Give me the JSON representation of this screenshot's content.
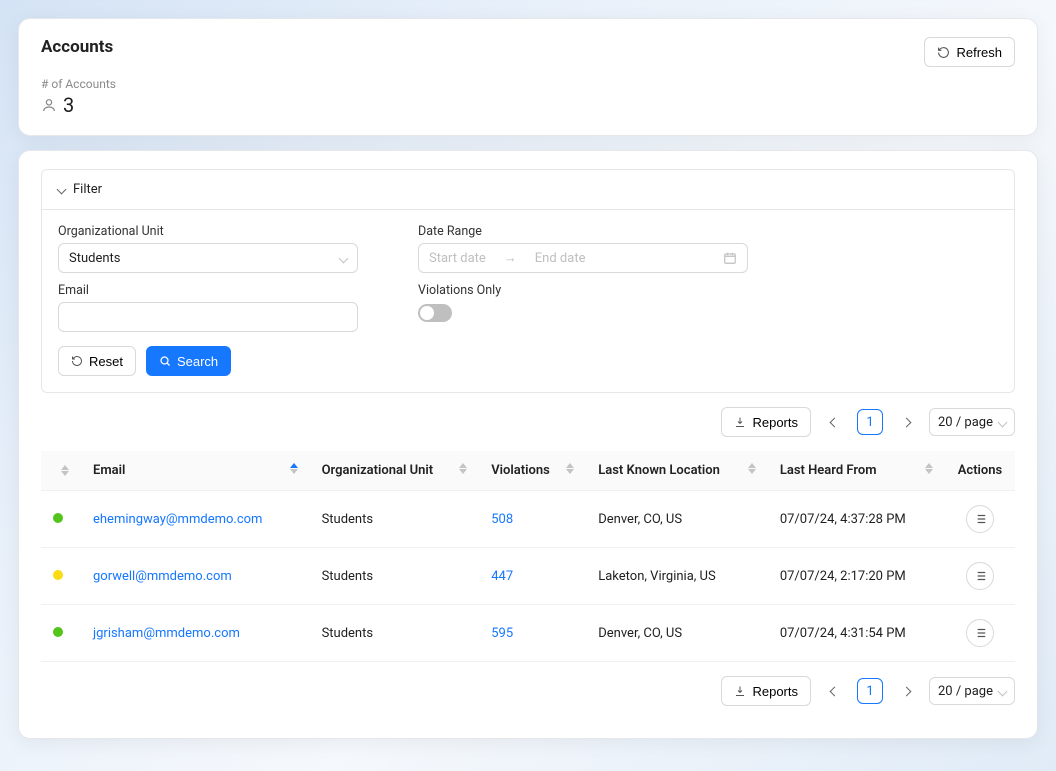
{
  "header": {
    "title": "Accounts",
    "refresh_label": "Refresh",
    "count_label": "# of Accounts",
    "count_value": "3"
  },
  "filter": {
    "title": "Filter",
    "org_unit_label": "Organizational Unit",
    "org_unit_value": "Students",
    "email_label": "Email",
    "date_range_label": "Date Range",
    "start_placeholder": "Start date",
    "end_placeholder": "End date",
    "violations_only_label": "Violations Only",
    "reset_label": "Reset",
    "search_label": "Search"
  },
  "toolbar": {
    "reports_label": "Reports",
    "page": "1",
    "page_size": "20 / page"
  },
  "table": {
    "columns": {
      "email": "Email",
      "org_unit": "Organizational Unit",
      "violations": "Violations",
      "location": "Last Known Location",
      "last_heard": "Last Heard From",
      "actions": "Actions"
    },
    "rows": [
      {
        "status_color": "#52c41a",
        "email": "ehemingway@mmdemo.com",
        "org_unit": "Students",
        "violations": "508",
        "location": "Denver, CO, US",
        "last_heard": "07/07/24, 4:37:28 PM"
      },
      {
        "status_color": "#fadb14",
        "email": "gorwell@mmdemo.com",
        "org_unit": "Students",
        "violations": "447",
        "location": "Laketon, Virginia, US",
        "last_heard": "07/07/24, 2:17:20 PM"
      },
      {
        "status_color": "#52c41a",
        "email": "jgrisham@mmdemo.com",
        "org_unit": "Students",
        "violations": "595",
        "location": "Denver, CO, US",
        "last_heard": "07/07/24, 4:31:54 PM"
      }
    ]
  }
}
